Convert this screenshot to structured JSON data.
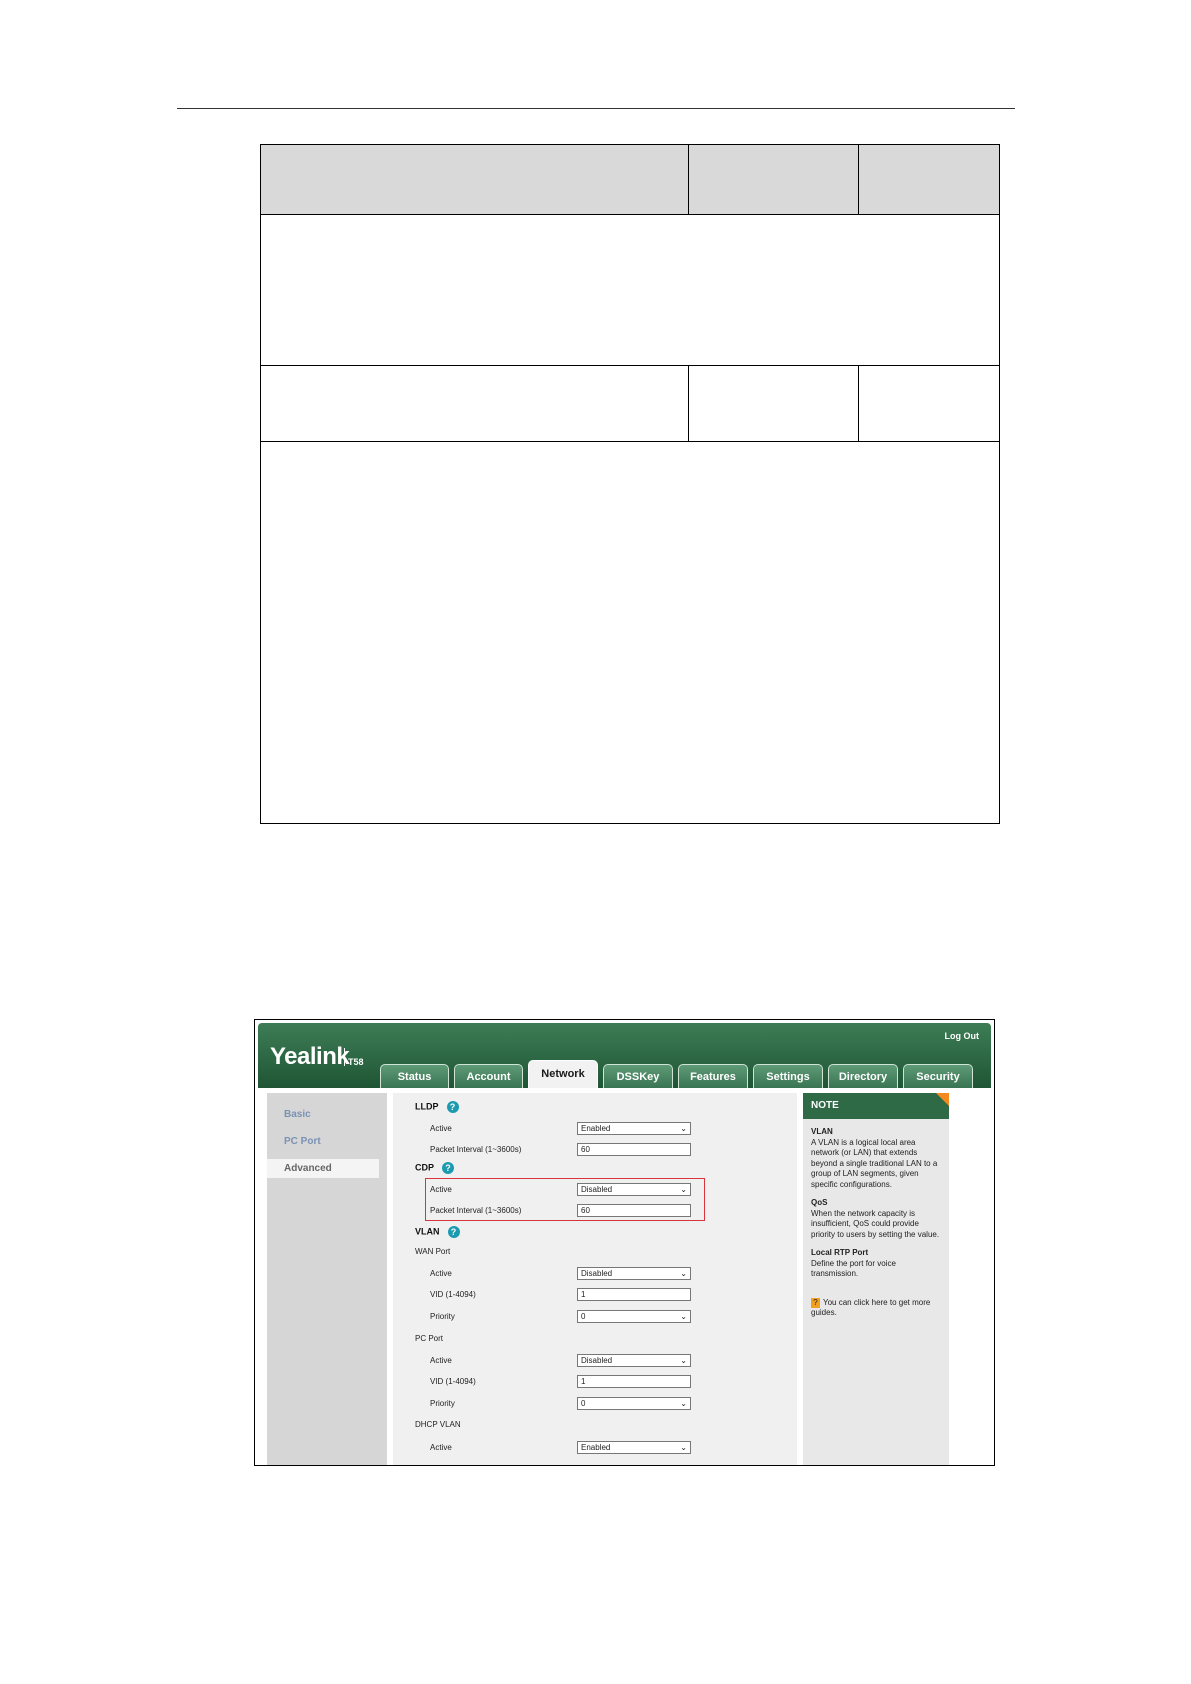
{
  "screenshot": {
    "logout": "Log Out",
    "logo": "Yealink",
    "model": "T58",
    "tabs": [
      "Status",
      "Account",
      "Network",
      "DSSKey",
      "Features",
      "Settings",
      "Directory",
      "Security"
    ],
    "active_tab": "Network",
    "nav": [
      "Basic",
      "PC Port",
      "Advanced"
    ],
    "active_nav": "Advanced",
    "lldp": {
      "title": "LLDP",
      "active_label": "Active",
      "active_value": "Enabled",
      "interval_label": "Packet Interval (1~3600s)",
      "interval_value": "60"
    },
    "cdp": {
      "title": "CDP",
      "active_label": "Active",
      "active_value": "Disabled",
      "interval_label": "Packet Interval (1~3600s)",
      "interval_value": "60"
    },
    "vlan": {
      "title": "VLAN",
      "wan_port": "WAN Port",
      "wan_active_label": "Active",
      "wan_active_value": "Disabled",
      "wan_vid_label": "VID (1-4094)",
      "wan_vid_value": "1",
      "wan_priority_label": "Priority",
      "wan_priority_value": "0",
      "pc_port": "PC Port",
      "pc_active_label": "Active",
      "pc_active_value": "Disabled",
      "pc_vid_label": "VID (1-4094)",
      "pc_vid_value": "1",
      "pc_priority_label": "Priority",
      "pc_priority_value": "0",
      "dhcp_vlan": "DHCP VLAN",
      "dhcp_active_label": "Active",
      "dhcp_active_value": "Enabled"
    },
    "note": {
      "title": "NOTE",
      "vlan_title": "VLAN",
      "vlan_text": "A VLAN is a logical local area network (or LAN) that extends beyond a single traditional LAN to a group of LAN segments, given specific configurations.",
      "qos_title": "QoS",
      "qos_text": "When the network capacity is insufficient, QoS could provide priority to users by setting the value.",
      "rtp_title": "Local RTP Port",
      "rtp_text": "Define the port for voice transmission.",
      "guide_icon": "?",
      "guide_text": "You can click here to get more guides."
    },
    "colors": {
      "green": "#2f6a47",
      "highlight": "#d9333b",
      "help": "#1c9bb0",
      "corner": "#f28a1e"
    }
  }
}
